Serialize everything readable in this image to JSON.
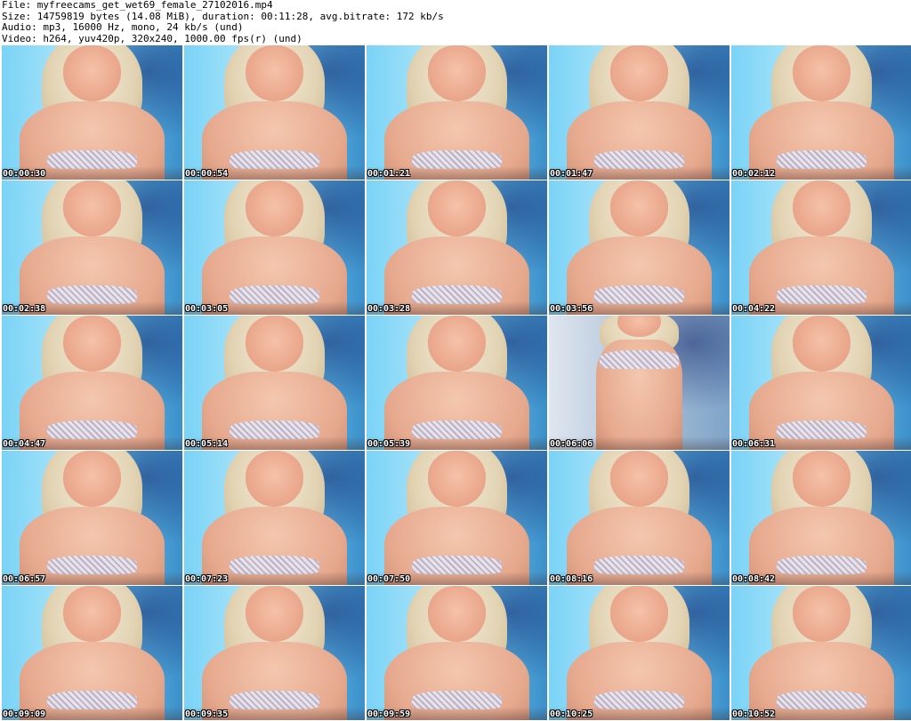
{
  "header": {
    "file": "File: myfreecams_get_wet69_female_27102016.mp4",
    "size": "Size: 14759819 bytes (14.08 MiB), duration: 00:11:28, avg.bitrate: 172 kb/s",
    "audio": "Audio: mp3, 16000 Hz, mono, 24 kb/s (und)",
    "video": "Video: h264, yuv420p, 320x240, 1000.00 fps(r) (und)"
  },
  "thumbnails": [
    {
      "timestamp": "00:00:30"
    },
    {
      "timestamp": "00:00:54"
    },
    {
      "timestamp": "00:01:21"
    },
    {
      "timestamp": "00:01:47"
    },
    {
      "timestamp": "00:02:12"
    },
    {
      "timestamp": "00:02:38"
    },
    {
      "timestamp": "00:03:05"
    },
    {
      "timestamp": "00:03:28"
    },
    {
      "timestamp": "00:03:56"
    },
    {
      "timestamp": "00:04:22"
    },
    {
      "timestamp": "00:04:47"
    },
    {
      "timestamp": "00:05:14"
    },
    {
      "timestamp": "00:05:39"
    },
    {
      "timestamp": "00:06:06"
    },
    {
      "timestamp": "00:06:31"
    },
    {
      "timestamp": "00:06:57"
    },
    {
      "timestamp": "00:07:23"
    },
    {
      "timestamp": "00:07:50"
    },
    {
      "timestamp": "00:08:16"
    },
    {
      "timestamp": "00:08:42"
    },
    {
      "timestamp": "00:09:09"
    },
    {
      "timestamp": "00:09:35"
    },
    {
      "timestamp": "00:09:59"
    },
    {
      "timestamp": "00:10:25"
    },
    {
      "timestamp": "00:10:52"
    }
  ]
}
